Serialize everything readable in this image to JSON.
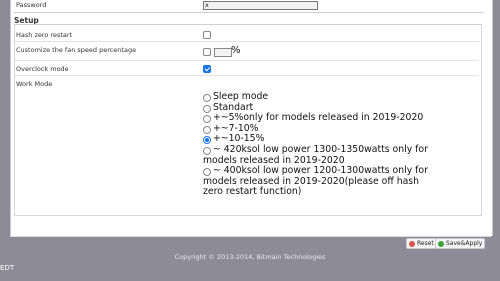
{
  "password": {
    "label": "Password",
    "value": "x"
  },
  "setup": {
    "title": "Setup",
    "hash_zero_restart": {
      "label": "Hash zero restart",
      "checked": false
    },
    "fan_speed": {
      "label": "Customize the fan speed percentage",
      "checked": false,
      "value": "",
      "unit": "%"
    },
    "overclock_mode": {
      "label": "Overclock mode",
      "checked": true
    },
    "work_mode": {
      "label": "Work Mode",
      "options": [
        {
          "label": "Sleep mode",
          "selected": false
        },
        {
          "label": "Standart",
          "selected": false
        },
        {
          "label": "+~5%only for models released in 2019-2020",
          "selected": false
        },
        {
          "label": "+~7-10%",
          "selected": false
        },
        {
          "label": "+~10-15%",
          "selected": true
        },
        {
          "line1": "~ 420ksol low power 1300-1350watts only for",
          "line2": "models released in 2019-2020",
          "selected": false
        },
        {
          "line1": "~ 400ksol low power 1200-1300watts only for",
          "line2": "models released in 2019-2020(please off hash",
          "line3": "zero restart function)",
          "selected": false
        }
      ]
    }
  },
  "buttons": {
    "reset": "Reset",
    "save_apply": "Save&Apply"
  },
  "footer": {
    "copyright": "Copyright © 2013-2014, Bitmain Technologies"
  },
  "corner_label": "EDT",
  "colors": {
    "accent": "#1a73e8",
    "background": "#8e8b99"
  }
}
